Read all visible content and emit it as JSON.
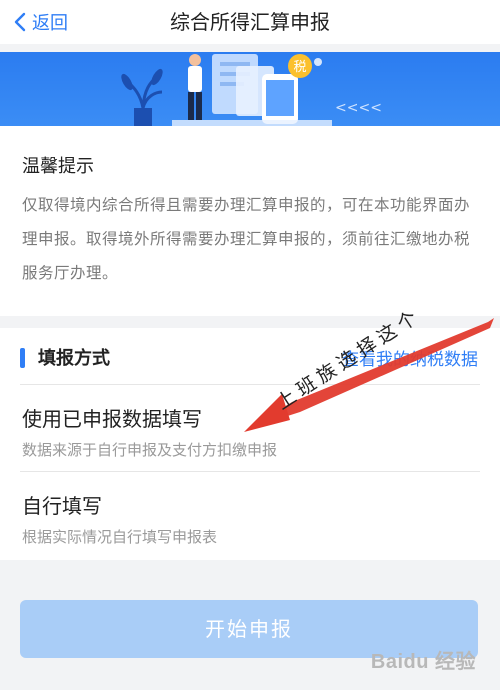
{
  "nav": {
    "back_label": "返回",
    "title": "综合所得汇算申报"
  },
  "banner": {
    "tax_badge": "税",
    "arrows": "<<<<",
    "colors": {
      "bg": "#2b7cf0",
      "accent": "#fbc02d"
    }
  },
  "tips": {
    "title": "温馨提示",
    "body": "仅取得境内综合所得且需要办理汇算申报的，可在本功能界面办理申报。取得境外所得需要办理汇算申报的，须前往汇缴地办税服务厅办理。"
  },
  "method": {
    "section_title": "填报方式",
    "link_label": "查看我的纳税数据",
    "options": [
      {
        "title": "使用已申报数据填写",
        "desc": "数据来源于自行申报及支付方扣缴申报"
      },
      {
        "title": "自行填写",
        "desc": "根据实际情况自行填写申报表"
      }
    ]
  },
  "start_button": "开始申报",
  "annotation": {
    "text": "上班族选择这个",
    "color": "#e23b2e"
  },
  "watermark": "Baidu 经验",
  "colors": {
    "primary": "#2f7ef6",
    "disabled_btn": "#a9cdf7",
    "page_bg": "#f2f3f5"
  }
}
